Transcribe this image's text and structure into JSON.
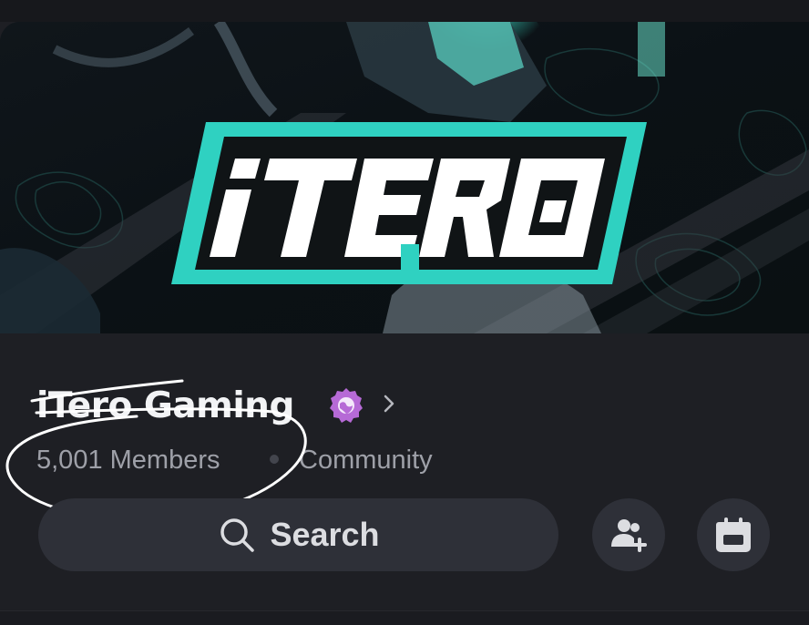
{
  "colors": {
    "background": "#1e1f24",
    "accent_teal": "#2fd1c1",
    "badge_purple": "#b66ad6",
    "text_primary": "#f2f3f5",
    "text_secondary": "#9ea0a8",
    "button_bg": "#2e3038"
  },
  "banner": {
    "logo_text": "iTERO",
    "icon": "server-banner-image"
  },
  "server": {
    "name": "iTero Gaming",
    "badge_icon": "community-globe-badge-icon",
    "chevron_icon": "chevron-right-icon",
    "members": "5,001 Members",
    "type": "Community"
  },
  "actions": {
    "search_label": "Search",
    "search_icon": "search-icon",
    "invite_icon": "add-user-icon",
    "events_icon": "calendar-icon"
  }
}
